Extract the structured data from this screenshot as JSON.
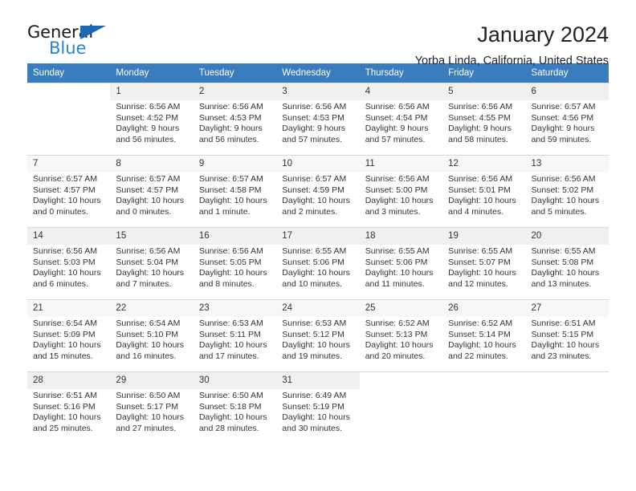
{
  "logo": {
    "text_primary": "General",
    "text_secondary": "Blue",
    "triangle_color": "#1c69b3",
    "secondary_color": "#2585d3"
  },
  "header": {
    "title": "January 2024",
    "subtitle": "Yorba Linda, California, United States"
  },
  "theme": {
    "header_row_background": "#3a7dbe",
    "header_row_text": "#ffffff",
    "daynum_background": "#f0f0f0",
    "grid_line": "#d9d9d9",
    "body_text": "#333333"
  },
  "calendar": {
    "weekday_headers": [
      "Sunday",
      "Monday",
      "Tuesday",
      "Wednesday",
      "Thursday",
      "Friday",
      "Saturday"
    ],
    "labels": {
      "sunrise": "Sunrise:",
      "sunset": "Sunset:",
      "daylight": "Daylight:"
    },
    "weeks": [
      [
        {
          "day": ""
        },
        {
          "day": "1",
          "sunrise": "Sunrise: 6:56 AM",
          "sunset": "Sunset: 4:52 PM",
          "daylight_line1": "Daylight: 9 hours",
          "daylight_line2": "and 56 minutes."
        },
        {
          "day": "2",
          "sunrise": "Sunrise: 6:56 AM",
          "sunset": "Sunset: 4:53 PM",
          "daylight_line1": "Daylight: 9 hours",
          "daylight_line2": "and 56 minutes."
        },
        {
          "day": "3",
          "sunrise": "Sunrise: 6:56 AM",
          "sunset": "Sunset: 4:53 PM",
          "daylight_line1": "Daylight: 9 hours",
          "daylight_line2": "and 57 minutes."
        },
        {
          "day": "4",
          "sunrise": "Sunrise: 6:56 AM",
          "sunset": "Sunset: 4:54 PM",
          "daylight_line1": "Daylight: 9 hours",
          "daylight_line2": "and 57 minutes."
        },
        {
          "day": "5",
          "sunrise": "Sunrise: 6:56 AM",
          "sunset": "Sunset: 4:55 PM",
          "daylight_line1": "Daylight: 9 hours",
          "daylight_line2": "and 58 minutes."
        },
        {
          "day": "6",
          "sunrise": "Sunrise: 6:57 AM",
          "sunset": "Sunset: 4:56 PM",
          "daylight_line1": "Daylight: 9 hours",
          "daylight_line2": "and 59 minutes."
        }
      ],
      [
        {
          "day": "7",
          "sunrise": "Sunrise: 6:57 AM",
          "sunset": "Sunset: 4:57 PM",
          "daylight_line1": "Daylight: 10 hours",
          "daylight_line2": "and 0 minutes."
        },
        {
          "day": "8",
          "sunrise": "Sunrise: 6:57 AM",
          "sunset": "Sunset: 4:57 PM",
          "daylight_line1": "Daylight: 10 hours",
          "daylight_line2": "and 0 minutes."
        },
        {
          "day": "9",
          "sunrise": "Sunrise: 6:57 AM",
          "sunset": "Sunset: 4:58 PM",
          "daylight_line1": "Daylight: 10 hours",
          "daylight_line2": "and 1 minute."
        },
        {
          "day": "10",
          "sunrise": "Sunrise: 6:57 AM",
          "sunset": "Sunset: 4:59 PM",
          "daylight_line1": "Daylight: 10 hours",
          "daylight_line2": "and 2 minutes."
        },
        {
          "day": "11",
          "sunrise": "Sunrise: 6:56 AM",
          "sunset": "Sunset: 5:00 PM",
          "daylight_line1": "Daylight: 10 hours",
          "daylight_line2": "and 3 minutes."
        },
        {
          "day": "12",
          "sunrise": "Sunrise: 6:56 AM",
          "sunset": "Sunset: 5:01 PM",
          "daylight_line1": "Daylight: 10 hours",
          "daylight_line2": "and 4 minutes."
        },
        {
          "day": "13",
          "sunrise": "Sunrise: 6:56 AM",
          "sunset": "Sunset: 5:02 PM",
          "daylight_line1": "Daylight: 10 hours",
          "daylight_line2": "and 5 minutes."
        }
      ],
      [
        {
          "day": "14",
          "sunrise": "Sunrise: 6:56 AM",
          "sunset": "Sunset: 5:03 PM",
          "daylight_line1": "Daylight: 10 hours",
          "daylight_line2": "and 6 minutes."
        },
        {
          "day": "15",
          "sunrise": "Sunrise: 6:56 AM",
          "sunset": "Sunset: 5:04 PM",
          "daylight_line1": "Daylight: 10 hours",
          "daylight_line2": "and 7 minutes."
        },
        {
          "day": "16",
          "sunrise": "Sunrise: 6:56 AM",
          "sunset": "Sunset: 5:05 PM",
          "daylight_line1": "Daylight: 10 hours",
          "daylight_line2": "and 8 minutes."
        },
        {
          "day": "17",
          "sunrise": "Sunrise: 6:55 AM",
          "sunset": "Sunset: 5:06 PM",
          "daylight_line1": "Daylight: 10 hours",
          "daylight_line2": "and 10 minutes."
        },
        {
          "day": "18",
          "sunrise": "Sunrise: 6:55 AM",
          "sunset": "Sunset: 5:06 PM",
          "daylight_line1": "Daylight: 10 hours",
          "daylight_line2": "and 11 minutes."
        },
        {
          "day": "19",
          "sunrise": "Sunrise: 6:55 AM",
          "sunset": "Sunset: 5:07 PM",
          "daylight_line1": "Daylight: 10 hours",
          "daylight_line2": "and 12 minutes."
        },
        {
          "day": "20",
          "sunrise": "Sunrise: 6:55 AM",
          "sunset": "Sunset: 5:08 PM",
          "daylight_line1": "Daylight: 10 hours",
          "daylight_line2": "and 13 minutes."
        }
      ],
      [
        {
          "day": "21",
          "sunrise": "Sunrise: 6:54 AM",
          "sunset": "Sunset: 5:09 PM",
          "daylight_line1": "Daylight: 10 hours",
          "daylight_line2": "and 15 minutes."
        },
        {
          "day": "22",
          "sunrise": "Sunrise: 6:54 AM",
          "sunset": "Sunset: 5:10 PM",
          "daylight_line1": "Daylight: 10 hours",
          "daylight_line2": "and 16 minutes."
        },
        {
          "day": "23",
          "sunrise": "Sunrise: 6:53 AM",
          "sunset": "Sunset: 5:11 PM",
          "daylight_line1": "Daylight: 10 hours",
          "daylight_line2": "and 17 minutes."
        },
        {
          "day": "24",
          "sunrise": "Sunrise: 6:53 AM",
          "sunset": "Sunset: 5:12 PM",
          "daylight_line1": "Daylight: 10 hours",
          "daylight_line2": "and 19 minutes."
        },
        {
          "day": "25",
          "sunrise": "Sunrise: 6:52 AM",
          "sunset": "Sunset: 5:13 PM",
          "daylight_line1": "Daylight: 10 hours",
          "daylight_line2": "and 20 minutes."
        },
        {
          "day": "26",
          "sunrise": "Sunrise: 6:52 AM",
          "sunset": "Sunset: 5:14 PM",
          "daylight_line1": "Daylight: 10 hours",
          "daylight_line2": "and 22 minutes."
        },
        {
          "day": "27",
          "sunrise": "Sunrise: 6:51 AM",
          "sunset": "Sunset: 5:15 PM",
          "daylight_line1": "Daylight: 10 hours",
          "daylight_line2": "and 23 minutes."
        }
      ],
      [
        {
          "day": "28",
          "sunrise": "Sunrise: 6:51 AM",
          "sunset": "Sunset: 5:16 PM",
          "daylight_line1": "Daylight: 10 hours",
          "daylight_line2": "and 25 minutes."
        },
        {
          "day": "29",
          "sunrise": "Sunrise: 6:50 AM",
          "sunset": "Sunset: 5:17 PM",
          "daylight_line1": "Daylight: 10 hours",
          "daylight_line2": "and 27 minutes."
        },
        {
          "day": "30",
          "sunrise": "Sunrise: 6:50 AM",
          "sunset": "Sunset: 5:18 PM",
          "daylight_line1": "Daylight: 10 hours",
          "daylight_line2": "and 28 minutes."
        },
        {
          "day": "31",
          "sunrise": "Sunrise: 6:49 AM",
          "sunset": "Sunset: 5:19 PM",
          "daylight_line1": "Daylight: 10 hours",
          "daylight_line2": "and 30 minutes."
        },
        {
          "day": ""
        },
        {
          "day": ""
        },
        {
          "day": ""
        }
      ]
    ]
  }
}
